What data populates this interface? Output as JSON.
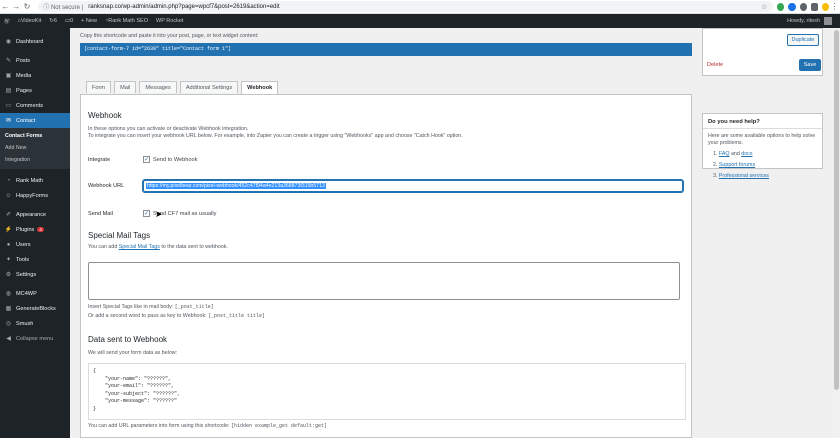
{
  "browser": {
    "security_label": "Not secure",
    "url": "ranksnap.co/wp-admin/admin.php?page=wpcf7&post=2619&action=edit"
  },
  "adminbar": {
    "site_name": "VideoKit",
    "updates_count": "6",
    "comments_count": "0",
    "new_label": "+ New",
    "rank_math_label": "Rank Math SEO",
    "wp_rocket_label": "WP Rocket",
    "howdy": "Howdy, ritesh"
  },
  "sidebar": {
    "items": [
      {
        "label": "Dashboard",
        "icon": "dashboard-icon"
      },
      {
        "label": "Posts",
        "icon": "pin-icon"
      },
      {
        "label": "Media",
        "icon": "media-icon"
      },
      {
        "label": "Pages",
        "icon": "page-icon"
      },
      {
        "label": "Comments",
        "icon": "comment-icon"
      },
      {
        "label": "Contact",
        "icon": "mail-icon"
      },
      {
        "label": "Rank Math",
        "icon": "chart-icon"
      },
      {
        "label": "HappyForms",
        "icon": "smile-icon"
      },
      {
        "label": "Appearance",
        "icon": "brush-icon"
      },
      {
        "label": "Plugins",
        "icon": "plug-icon",
        "badge": "4"
      },
      {
        "label": "Users",
        "icon": "user-icon"
      },
      {
        "label": "Tools",
        "icon": "wrench-icon"
      },
      {
        "label": "Settings",
        "icon": "settings-icon"
      },
      {
        "label": "MC4WP",
        "icon": "mc4wp-icon"
      },
      {
        "label": "GenerateBlocks",
        "icon": "blocks-icon"
      },
      {
        "label": "Smush",
        "icon": "smush-icon"
      },
      {
        "label": "Collapse menu",
        "icon": "collapse-icon"
      }
    ],
    "contact_submenu": [
      "Contact Forms",
      "Add New",
      "Integration"
    ]
  },
  "shortcode": {
    "help": "Copy this shortcode and paste it into your post, page, or text widget content:",
    "code": "[contact-form-7 id=\"2639\" title=\"Contact form 1\"]"
  },
  "tabs": [
    "Form",
    "Mail",
    "Messages",
    "Additional Settings",
    "Webhook"
  ],
  "webhook": {
    "title": "Webhook",
    "desc1": "In these options you can activate or deactivate Webhook integration.",
    "desc2": "To integrate you can insert your webhook URL below. For example, into Zapier you can create a trigger using \"Webhooks\" app and choose \"Catch Hook\" option.",
    "integrate_label": "Integrate",
    "integrate_text": "Send to Webhook",
    "url_label": "Webhook URL",
    "url_value": "https://my.pixelbear.com/pixel-webhook/452c47f94a4e213a368873f315b5713",
    "sendmail_label": "Send Mail",
    "sendmail_text": "Send CF7 mail as usually"
  },
  "special": {
    "title": "Special Mail Tags",
    "desc_prefix": "You can add ",
    "desc_link": "Special Mail Tags",
    "desc_suffix": " to the data sent to webhook.",
    "hint1_prefix": "Insert Special Tags like in mail body: ",
    "hint1_code": "[_post_title]",
    "hint2_prefix": "Or add a second word to pass as key to Webhook: ",
    "hint2_code": "[_post_title title]"
  },
  "data_sent": {
    "title": "Data sent to Webhook",
    "desc": "We will send your form data as below:",
    "json": "{\n    \"your-name\": \"??????\",\n    \"your-email\": \"??????\",\n    \"your-subject\": \"??????\",\n    \"your-message\": \"??????\"\n}",
    "foot_prefix": "You can add URL parameters into form using this shortcode: ",
    "foot_code": "[hidden example_get default:get]"
  },
  "publish": {
    "duplicate": "Duplicate",
    "delete": "Delete",
    "save": "Save"
  },
  "help": {
    "title": "Do you need help?",
    "text": "Here are some available options to help solve your problems.",
    "links": [
      {
        "prefix": "1. ",
        "a": "FAQ",
        "mid": " and ",
        "b": "docs"
      },
      {
        "prefix": "2. ",
        "a": "Support forums"
      },
      {
        "prefix": "3. ",
        "a": "Professional services"
      }
    ]
  },
  "colors": {
    "admin_dark": "#1d2327",
    "accent": "#2271b1",
    "delete": "#b32d2e"
  }
}
